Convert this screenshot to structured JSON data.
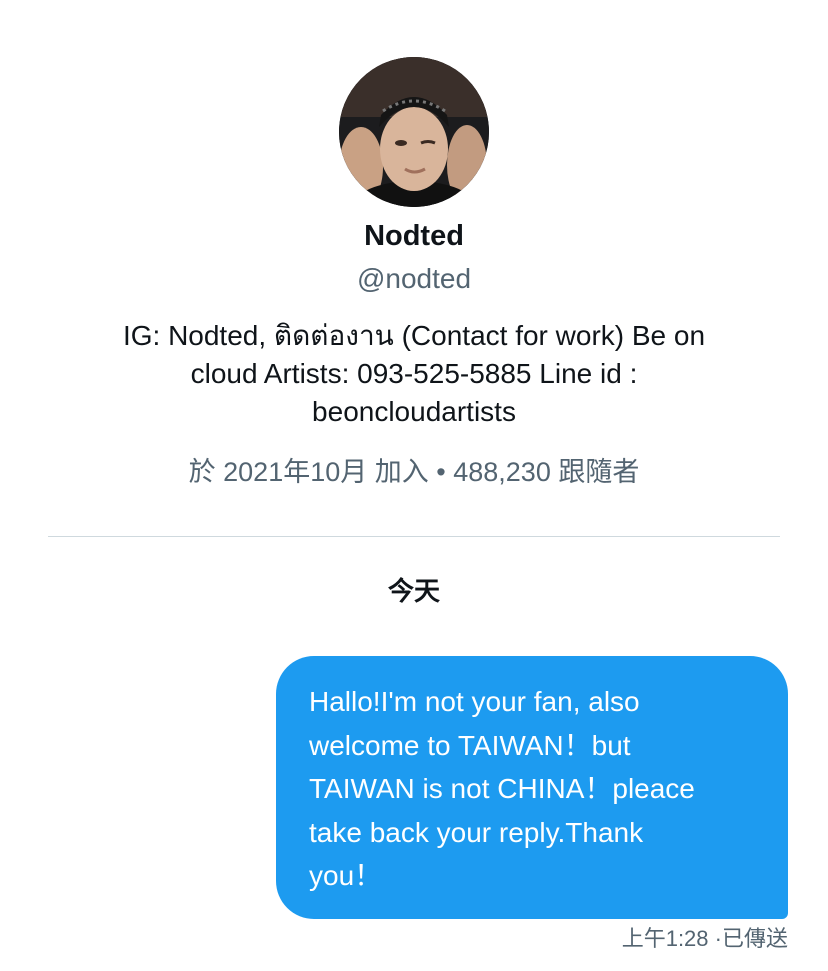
{
  "profile": {
    "display_name": "Nodted",
    "handle": "@nodted",
    "bio_lines": [
      "IG: Nodted, ติดต่องาน (Contact for work) Be on",
      "cloud Artists: 093-525-5885 Line id :",
      "beoncloudartists"
    ],
    "joined": "於 2021年10月 加入",
    "separator": "•",
    "followers": "488,230 跟隨者",
    "avatar_icon": "profile-photo"
  },
  "conversation": {
    "day_label": "今天",
    "messages": [
      {
        "lines": [
          "Hallo!I'm not your fan, also",
          "welcome to TAIWAN！but",
          "TAIWAN is not CHINA！pleace",
          "take back your reply.Thank",
          "you！"
        ],
        "time": "上午1:28",
        "status_sep": "·",
        "status": "已傳送"
      }
    ]
  },
  "colors": {
    "bubble": "#1d9bf0",
    "secondary_text": "#536471",
    "primary_text": "#0f1419",
    "divider": "#cfd9de"
  }
}
